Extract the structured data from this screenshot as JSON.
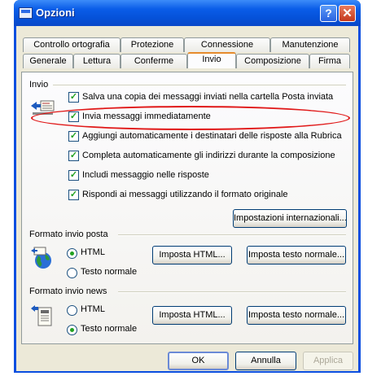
{
  "window": {
    "title": "Opzioni",
    "help_label": "?",
    "close_label": "✕"
  },
  "tabs": {
    "row1": [
      "Controllo ortografia",
      "Protezione",
      "Connessione",
      "Manutenzione"
    ],
    "row2": [
      "Generale",
      "Lettura",
      "Conferme",
      "Invio",
      "Composizione",
      "Firma"
    ],
    "active": "Invio"
  },
  "invio": {
    "label": "Invio",
    "icon": "send-mail-icon",
    "options": [
      {
        "label": "Salva una copia dei messaggi inviati nella cartella Posta inviata",
        "checked": true
      },
      {
        "label": "Invia messaggi immediatamente",
        "checked": true
      },
      {
        "label": "Aggiungi automaticamente i destinatari delle risposte alla Rubrica",
        "checked": true
      },
      {
        "label": "Completa automaticamente gli indirizzi durante la composizione",
        "checked": true
      },
      {
        "label": "Includi messaggio nelle risposte",
        "checked": true
      },
      {
        "label": "Rispondi ai messaggi utilizzando il formato originale",
        "checked": true
      }
    ],
    "intl_button": "Impostazioni internazionali..."
  },
  "formato_posta": {
    "label": "Formato invio posta",
    "icon": "globe-mail-icon",
    "radio_html": "HTML",
    "radio_text": "Testo normale",
    "selected": "HTML",
    "btn_html": "Imposta HTML...",
    "btn_text": "Imposta testo normale..."
  },
  "formato_news": {
    "label": "Formato invio news",
    "icon": "news-document-icon",
    "radio_html": "HTML",
    "radio_text": "Testo normale",
    "selected": "Testo normale",
    "btn_html": "Imposta HTML...",
    "btn_text": "Imposta testo normale..."
  },
  "footer": {
    "ok": "OK",
    "cancel": "Annulla",
    "apply": "Applica"
  },
  "colors": {
    "titlebar": "#0a5de8",
    "face": "#ece9d8",
    "highlight_ellipse": "#e01818",
    "check": "#21a121"
  }
}
